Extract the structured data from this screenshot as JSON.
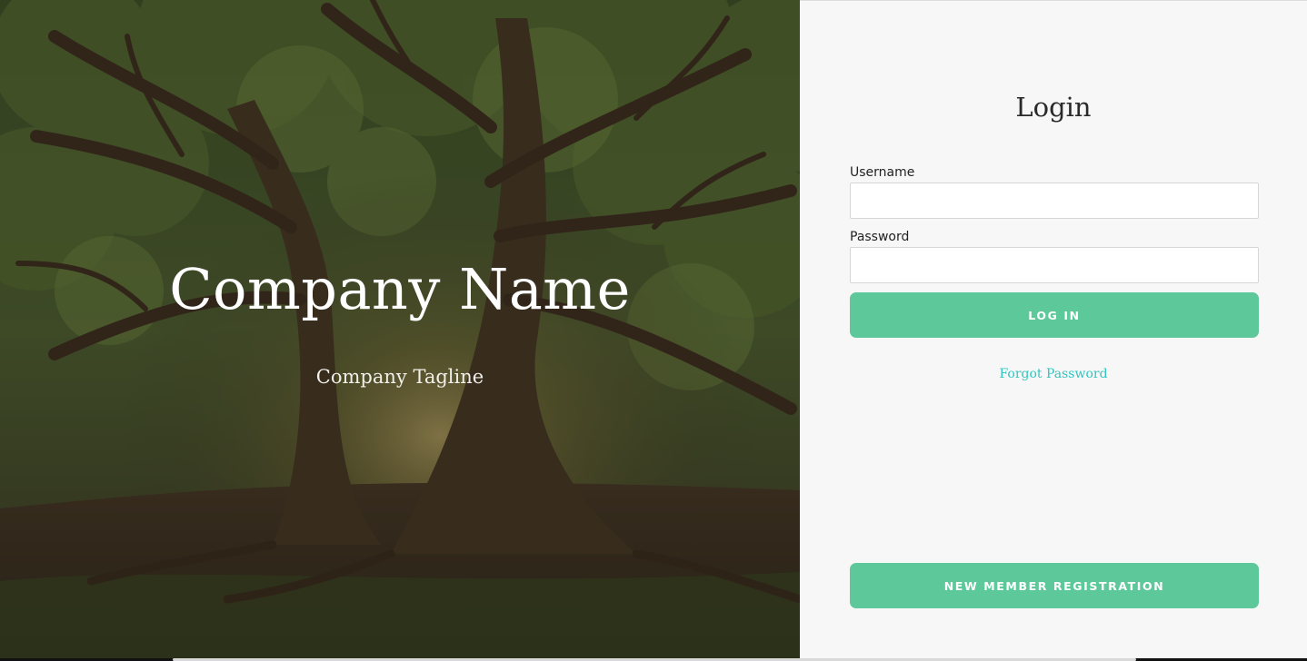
{
  "hero": {
    "company_name": "Company Name",
    "tagline": "Company Tagline"
  },
  "login": {
    "title": "Login",
    "username_label": "Username",
    "username_value": "",
    "password_label": "Password",
    "password_value": "",
    "login_button": "LOG IN",
    "forgot_password": "Forgot Password",
    "register_button": "NEW MEMBER REGISTRATION"
  },
  "colors": {
    "accent_button": "#5dc99a",
    "link": "#2fc6c0",
    "panel_background": "#f7f7f7"
  }
}
